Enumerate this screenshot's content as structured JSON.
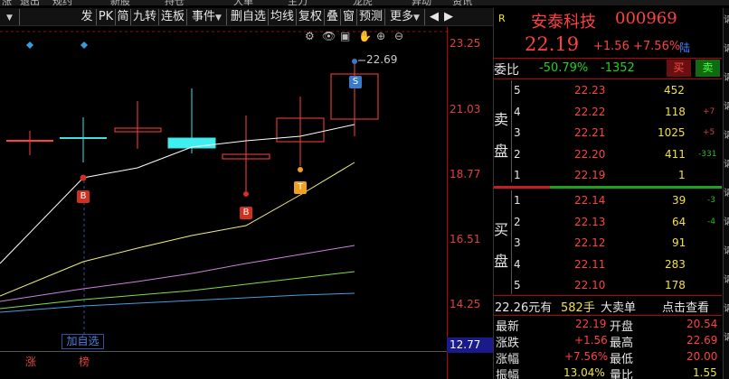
{
  "top_strip": {
    "items": [
      "涨",
      "退出",
      "规约",
      "新股",
      "持仓",
      "大单",
      "主力",
      "龙虎",
      "异动",
      "资讯"
    ]
  },
  "toolbar": {
    "items": [
      {
        "label": "发"
      },
      {
        "label": "PK"
      },
      {
        "label": "简"
      },
      {
        "label": "九转"
      },
      {
        "label": "连板"
      },
      {
        "label": "事件"
      },
      {
        "label": "删自选"
      },
      {
        "label": "均线"
      },
      {
        "label": "复权"
      },
      {
        "label": "叠"
      },
      {
        "label": "窗"
      },
      {
        "label": "预测"
      },
      {
        "label": "更多"
      }
    ],
    "dropdown_glyph": "▼"
  },
  "chart": {
    "price_axis": [
      "23.25",
      "21.03",
      "18.77",
      "16.51",
      "14.25"
    ],
    "current_price_label": "12.77",
    "high_marker": "22.69",
    "markers": {
      "buy1": "B",
      "buy2": "B",
      "t": "T",
      "s": "S"
    },
    "add_self_label": "加自选",
    "bottom_labels": [
      "涨",
      "榜"
    ],
    "icons": [
      "settings-icon",
      "eye-icon",
      "bag-icon",
      "hand-icon",
      "zoom-in-icon",
      "zoom-out-icon"
    ],
    "icon_glyphs": [
      "⚙",
      "👁",
      "▣",
      "✋",
      "⊕",
      "⊖"
    ],
    "colors": {
      "up": "#ff4040",
      "down": "#40e0e0",
      "ma5": "#ffffff",
      "ma10": "#f0f080",
      "ma20": "#d080e0",
      "ma30": "#80e040",
      "ma60": "#40a0e0"
    }
  },
  "quote": {
    "r_label": "R",
    "name": "安泰科技",
    "code": "000969",
    "price": "22.19",
    "change": "+1.56",
    "change_pct": "+7.56%",
    "board_tag": "陆",
    "weibi_label": "委比",
    "weibi_pct": "-50.79%",
    "weicha": "-1352",
    "buy_button": "买",
    "sell_button": "卖",
    "sell_label_1": "卖",
    "sell_label_2": "盘",
    "buy_label_1": "买",
    "buy_label_2": "盘",
    "asks": [
      {
        "lvl": "5",
        "price": "22.23",
        "vol": "452",
        "chg": ""
      },
      {
        "lvl": "4",
        "price": "22.22",
        "vol": "118",
        "chg": "+7"
      },
      {
        "lvl": "3",
        "price": "22.21",
        "vol": "1025",
        "chg": "+5"
      },
      {
        "lvl": "2",
        "price": "22.20",
        "vol": "411",
        "chg": "-331"
      },
      {
        "lvl": "1",
        "price": "22.19",
        "vol": "1",
        "chg": ""
      }
    ],
    "bids": [
      {
        "lvl": "1",
        "price": "22.14",
        "vol": "39",
        "chg": "-3"
      },
      {
        "lvl": "2",
        "price": "22.13",
        "vol": "64",
        "chg": "-4"
      },
      {
        "lvl": "3",
        "price": "22.12",
        "vol": "91",
        "chg": ""
      },
      {
        "lvl": "4",
        "price": "22.11",
        "vol": "283",
        "chg": ""
      },
      {
        "lvl": "5",
        "price": "22.10",
        "vol": "178",
        "chg": ""
      }
    ],
    "big_order": {
      "price": "22.26元有",
      "qty": "582手",
      "label": "大卖单",
      "link": "点击查看"
    },
    "stats": [
      {
        "k1": "最新",
        "v1": "22.19",
        "k2": "开盘",
        "v2": "20.54"
      },
      {
        "k1": "涨跌",
        "v1": "+1.56",
        "k2": "最高",
        "v2": "22.69"
      },
      {
        "k1": "涨幅",
        "v1": "+7.56%",
        "k2": "最低",
        "v2": "20.00"
      },
      {
        "k1": "振幅",
        "v1": "13.04%",
        "k2": "量比",
        "v2": "1.55"
      }
    ],
    "side_glyphs": [
      "请",
      "请",
      "请",
      "请",
      "请",
      "请",
      "请",
      "请",
      "请",
      "请",
      "请",
      "请"
    ]
  }
}
